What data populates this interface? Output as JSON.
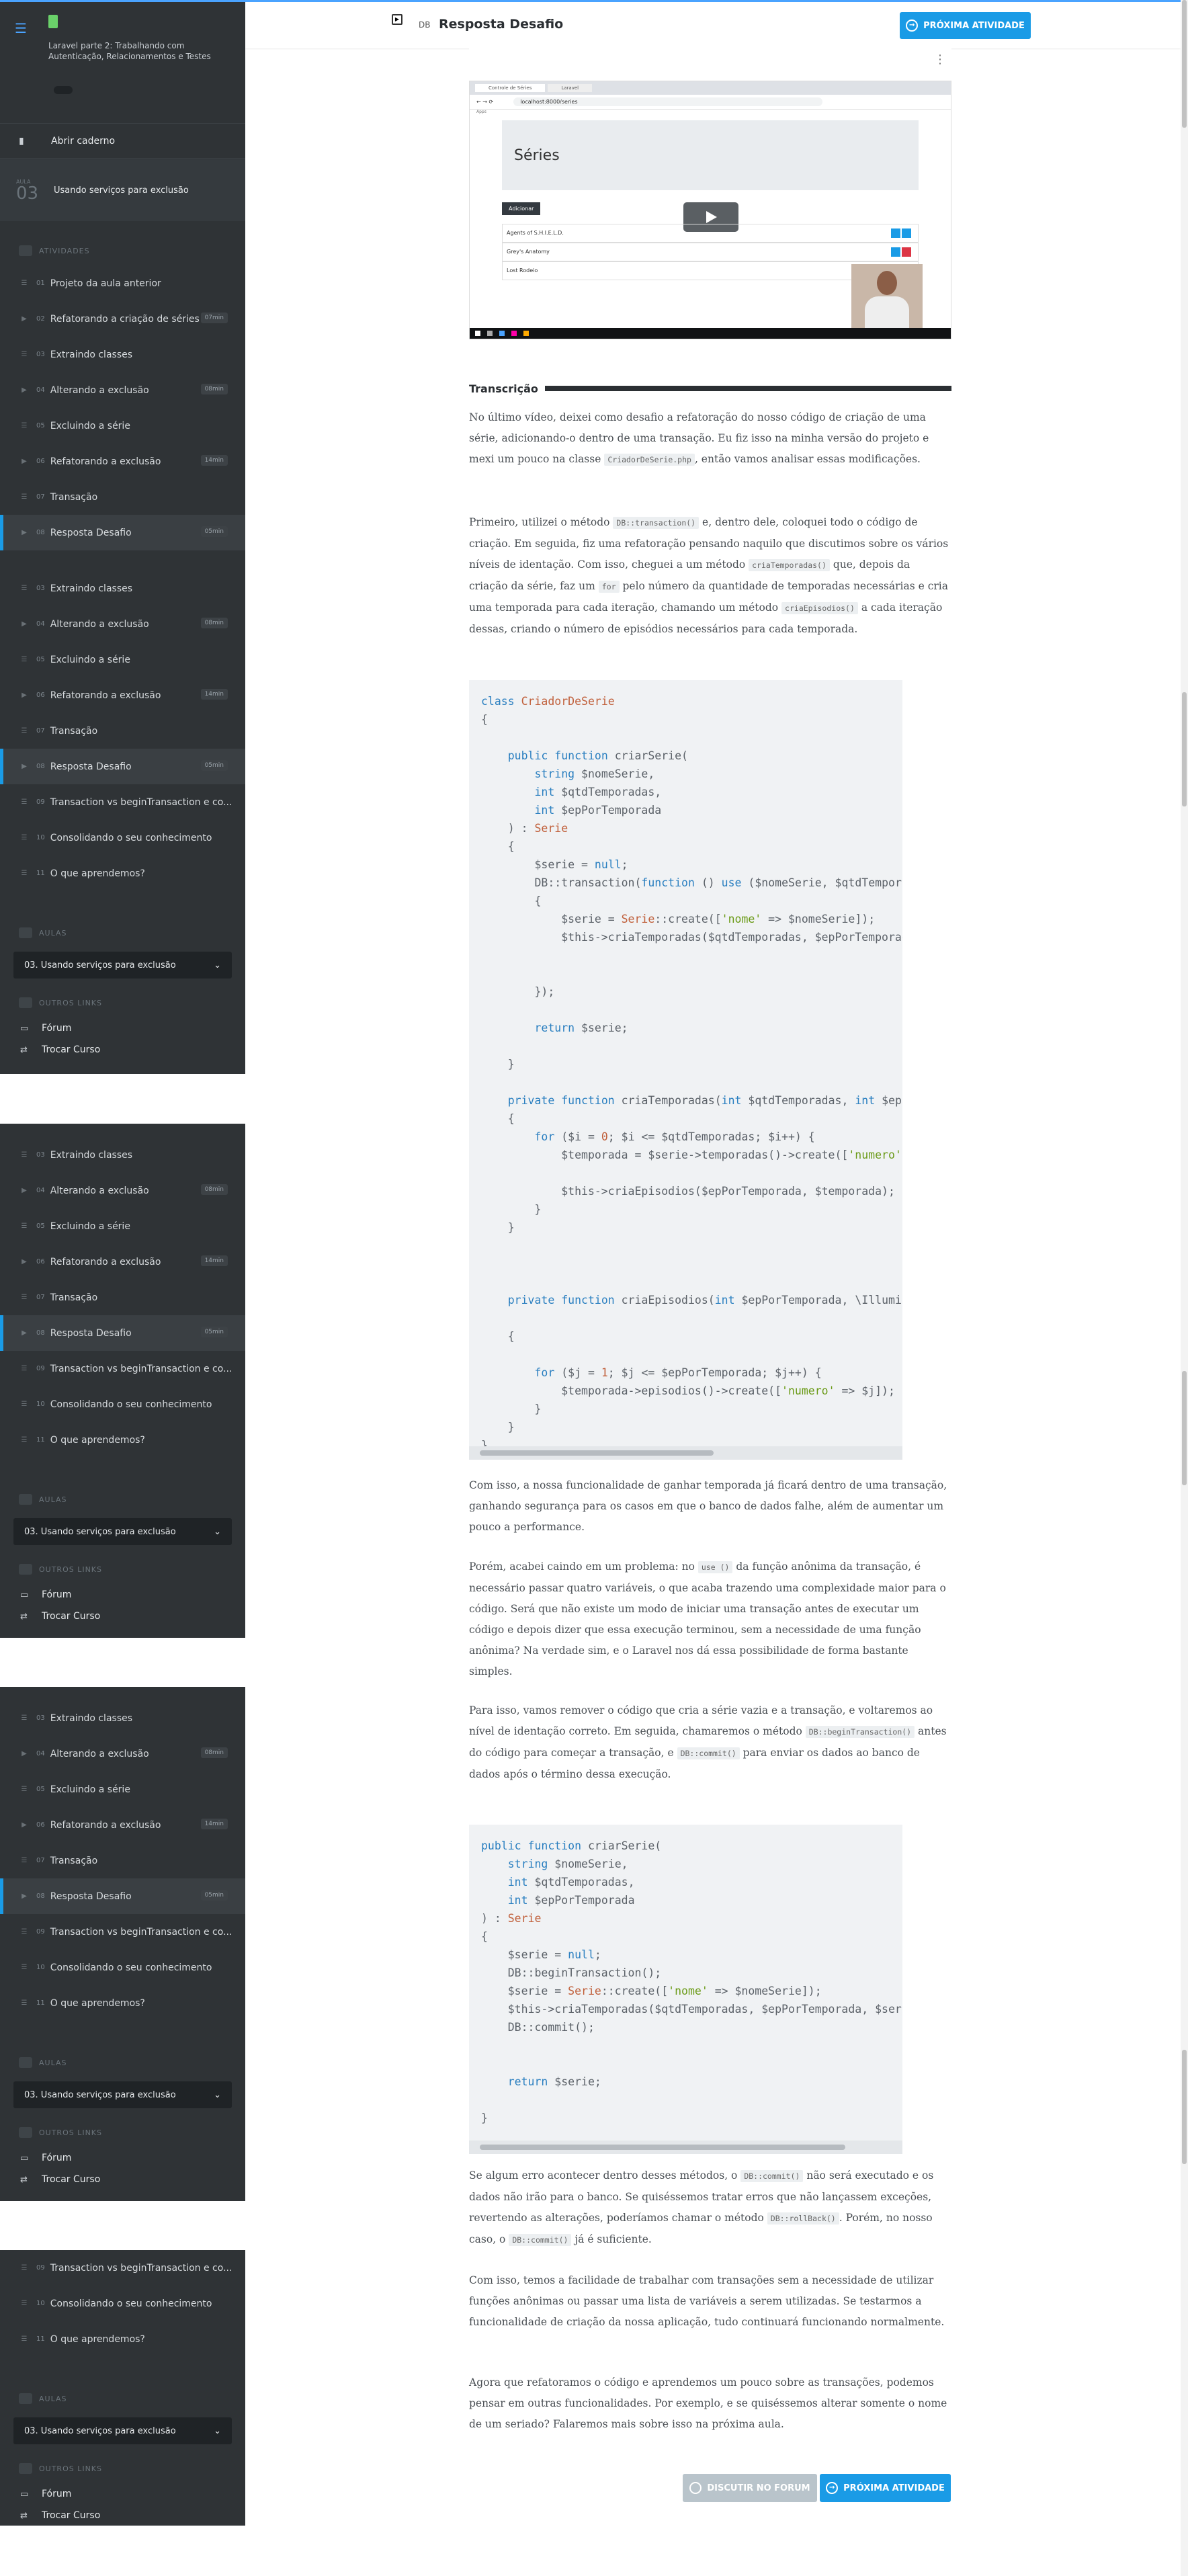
{
  "course": {
    "title": "Laravel parte 2: Trabalhando com Autenticação, Relacionamentos e Testes"
  },
  "sidebar": {
    "open_notebook": "Abrir caderno",
    "lesson_label": "AULA",
    "lesson_number": "03",
    "lesson_title": "Usando serviços para exclusão",
    "activities_label": "ATIVIDADES",
    "items": [
      {
        "num": "01",
        "label": "Projeto da aula anterior",
        "time": ""
      },
      {
        "num": "02",
        "label": "Refatorando a criação de séries",
        "time": "07min"
      },
      {
        "num": "03",
        "label": "Extraindo classes",
        "time": ""
      },
      {
        "num": "04",
        "label": "Alterando a exclusão",
        "time": "08min"
      },
      {
        "num": "05",
        "label": "Excluindo a série",
        "time": ""
      },
      {
        "num": "06",
        "label": "Refatorando a exclusão",
        "time": "14min"
      },
      {
        "num": "07",
        "label": "Transação",
        "time": ""
      },
      {
        "num": "08",
        "label": "Resposta Desafio",
        "time": "05min"
      },
      {
        "num": "09",
        "label": "Transaction vs beginTransaction e co...",
        "time": ""
      },
      {
        "num": "10",
        "label": "Consolidando o seu conhecimento",
        "time": ""
      },
      {
        "num": "11",
        "label": "O que aprendemos?",
        "time": ""
      }
    ],
    "classes_label": "AULAS",
    "select_value": "03. Usando serviços para exclusão",
    "other_links_label": "OUTROS LINKS",
    "forum": "Fórum",
    "switch_course": "Trocar Curso"
  },
  "header": {
    "tag": "DB",
    "title": "Resposta Desafio",
    "next_button": "PRÓXIMA ATIVIDADE"
  },
  "video": {
    "slide_title": "Séries",
    "add_button": "Adicionar",
    "rows": [
      "Agents of S.H.I.E.L.D.",
      "Grey's Anatomy",
      "Lost Rodeio"
    ],
    "browser_url": "localhost:8000/series"
  },
  "transcript": {
    "heading": "Transcrição",
    "p1": [
      "No último vídeo, deixei como desafio a refatoração do nosso código de criação de uma série, adicionando-o dentro de uma transação. Eu fiz isso na minha versão do projeto e mexi um pouco na classe ",
      "CriadorDeSerie.php",
      ", então vamos analisar essas modificações."
    ],
    "p2": [
      "Primeiro, utilizei o método ",
      "DB::transaction()",
      " e, dentro dele, coloquei todo o código de criação. Em seguida, fiz uma refatoração pensando naquilo que discutimos sobre os vários níveis de identação. Com isso, cheguei a um método ",
      "criaTemporadas()",
      " que, depois da criação da série, faz um ",
      "for",
      " pelo número da quantidade de temporadas necessárias e cria uma temporada para cada iteração, chamando um método ",
      "criaEpisodios()",
      " a cada iteração dessas, criando o número de episódios necessários para cada temporada."
    ],
    "p3": "Com isso, a nossa funcionalidade de ganhar temporada já ficará dentro de uma transação, ganhando segurança para os casos em que o banco de dados falhe, além de aumentar um pouco a performance.",
    "p4": [
      "Porém, acabei caindo em um problema: no ",
      "use ()",
      " da função anônima da transação, é necessário passar quatro variáveis, o que acaba trazendo uma complexidade maior para o código. Será que não existe um modo de iniciar uma transação antes de executar um código e depois dizer que essa execução terminou, sem a necessidade de uma função anônima? Na verdade sim, e o Laravel nos dá essa possibilidade de forma bastante simples."
    ],
    "p5": [
      "Para isso, vamos remover o código que cria a série vazia e a transação, e voltaremos ao nível de identação correto. Em seguida, chamaremos o método ",
      "DB::beginTransaction()",
      " antes do código para começar a transação, e ",
      "DB::commit()",
      " para enviar os dados ao banco de dados após o término dessa execução."
    ],
    "p6": [
      "Se algum erro acontecer dentro desses métodos, o ",
      "DB::commit()",
      " não será executado e os dados não irão para o banco. Se quiséssemos tratar erros que não lançassem exceções, revertendo as alterações, poderíamos chamar o método ",
      "DB::rollBack()",
      ". Porém, no nosso caso, o ",
      "DB::commit()",
      " já é suficiente."
    ],
    "p7": "Com isso, temos a facilidade de trabalhar com transações sem a necessidade de utilizar funções anônimas ou passar uma lista de variáveis a serem utilizadas. Se testarmos a funcionalidade de criação da nossa aplicação, tudo continuará funcionando normalmente.",
    "p8": "Agora que refatoramos o código e aprendemos um pouco sobre as transações, podemos pensar em outras funcionalidades. Por exemplo, e se quiséssemos alterar somente o nome de um seriado? Falaremos mais sobre isso na próxima aula."
  },
  "footer": {
    "discuss": "DISCUTIR NO FORUM",
    "next": "PRÓXIMA ATIVIDADE"
  },
  "colors": {
    "accent": "#1a9be6",
    "sidebar": "#2f3336"
  }
}
